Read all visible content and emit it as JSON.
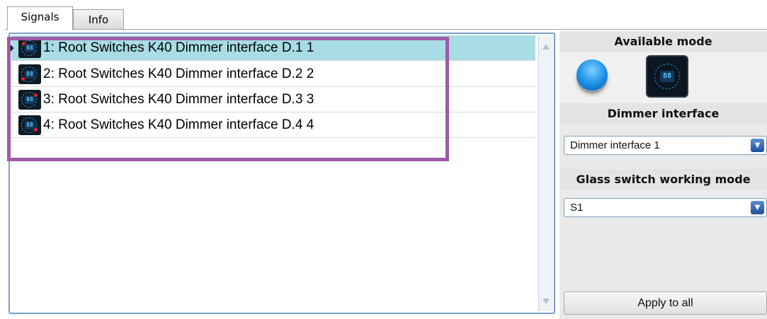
{
  "tabs": [
    {
      "label": "Signals",
      "active": true
    },
    {
      "label": "Info",
      "active": false
    }
  ],
  "signals": [
    {
      "label": "1: Root Switches K40 Dimmer interface D.1 1",
      "icon": "dimmer-interface-icon",
      "selected": true
    },
    {
      "label": "2: Root Switches K40 Dimmer interface D.2 2",
      "icon": "dimmer-interface-icon",
      "selected": false
    },
    {
      "label": "3: Root Switches K40 Dimmer interface D.3 3",
      "icon": "dimmer-interface-icon",
      "selected": false
    },
    {
      "label": "4: Root Switches K40 Dimmer interface D.4 4",
      "icon": "dimmer-interface-icon",
      "selected": false
    }
  ],
  "icon_text": "88",
  "side": {
    "available_mode_title": "Available mode",
    "modes": [
      {
        "icon": "push-button-icon"
      },
      {
        "icon": "dimmer-interface-icon",
        "icon_text": "88"
      }
    ],
    "dimmer_title": "Dimmer interface",
    "dimmer_value": "Dimmer interface 1",
    "glass_title": "Glass switch working mode",
    "glass_value": "S1",
    "apply_label": "Apply to all"
  },
  "colors": {
    "selected_row": "#a8dde5",
    "highlight_border": "#a05aa8",
    "list_border": "#7a9fc6"
  }
}
